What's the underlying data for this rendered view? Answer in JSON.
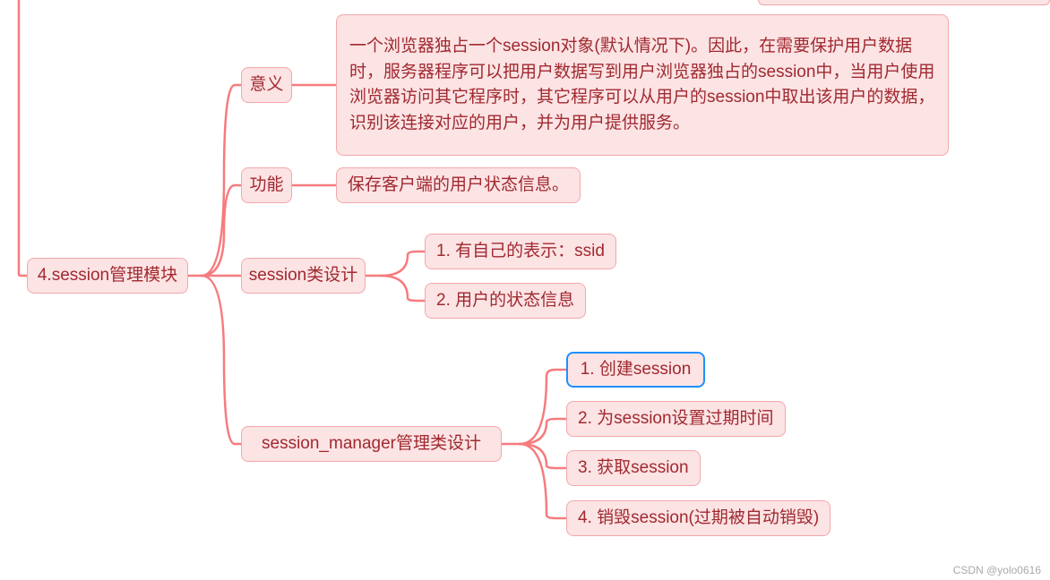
{
  "root": {
    "label": "4.session管理模块"
  },
  "level2": {
    "meaning": "意义",
    "function": "功能",
    "class_design": "session类设计",
    "manager_design": "session_manager管理类设计"
  },
  "meaning_text": "一个浏览器独占一个session对象(默认情况下)。因此，在需要保护用户数据时，服务器程序可以把用户数据写到用户浏览器独占的session中，当用户使用浏览器访问其它程序时，其它程序可以从用户的session中取出该用户的数据，识别该连接对应的用户，并为用户提供服务。",
  "function_text": "保存客户端的用户状态信息。",
  "class_items": {
    "item1": "1. 有自己的表示：ssid",
    "item2": "2. 用户的状态信息"
  },
  "manager_items": {
    "item1": "1. 创建session",
    "item2": "2. 为session设置过期时间",
    "item3": "3. 获取session",
    "item4": "4. 销毁session(过期被自动销毁)"
  },
  "watermark": "CSDN @yolo0616"
}
